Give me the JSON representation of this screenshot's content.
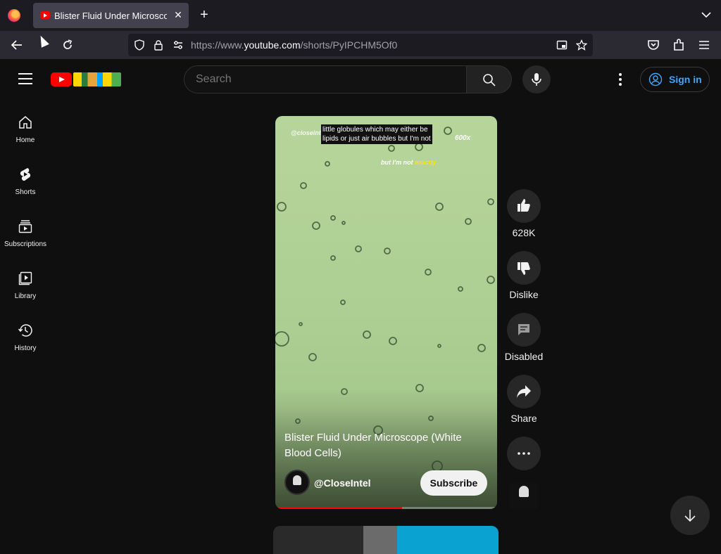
{
  "browser": {
    "tab_title": "Blister Fluid Under Microscope (White Blood Cells) - YouTube",
    "close_glyph": "✕",
    "new_tab_glyph": "+",
    "url_prefix": "https://www.",
    "url_domain": "youtube.com",
    "url_path": "/shorts/PyIPCHM5Of0"
  },
  "masthead": {
    "search_placeholder": "Search",
    "sign_in_label": "Sign in"
  },
  "guide": {
    "items": [
      {
        "label": "Home",
        "icon": "home-icon"
      },
      {
        "label": "Shorts",
        "icon": "shorts-icon"
      },
      {
        "label": "Subscriptions",
        "icon": "subscriptions-icon"
      },
      {
        "label": "Library",
        "icon": "library-icon"
      },
      {
        "label": "History",
        "icon": "history-icon"
      }
    ]
  },
  "short": {
    "caption_line1": "little globules which may either be",
    "caption_line2": "lipids or just air bubbles but I'm not",
    "watermark": "@closeintel",
    "magnification": "600x",
    "subtitle_prefix": "but I'm not",
    "subtitle_highlight": "exactly",
    "title": "Blister Fluid Under Microscope (White Blood Cells)",
    "channel": "@CloseIntel",
    "subscribe_label": "Subscribe",
    "progress": 0.57
  },
  "actions": {
    "like_count": "628K",
    "dislike_label": "Dislike",
    "comments_label": "Disabled",
    "share_label": "Share"
  },
  "colors": {
    "accent": "#ff0000",
    "link_blue": "#3ea6ff",
    "background": "#0f0f0f"
  }
}
